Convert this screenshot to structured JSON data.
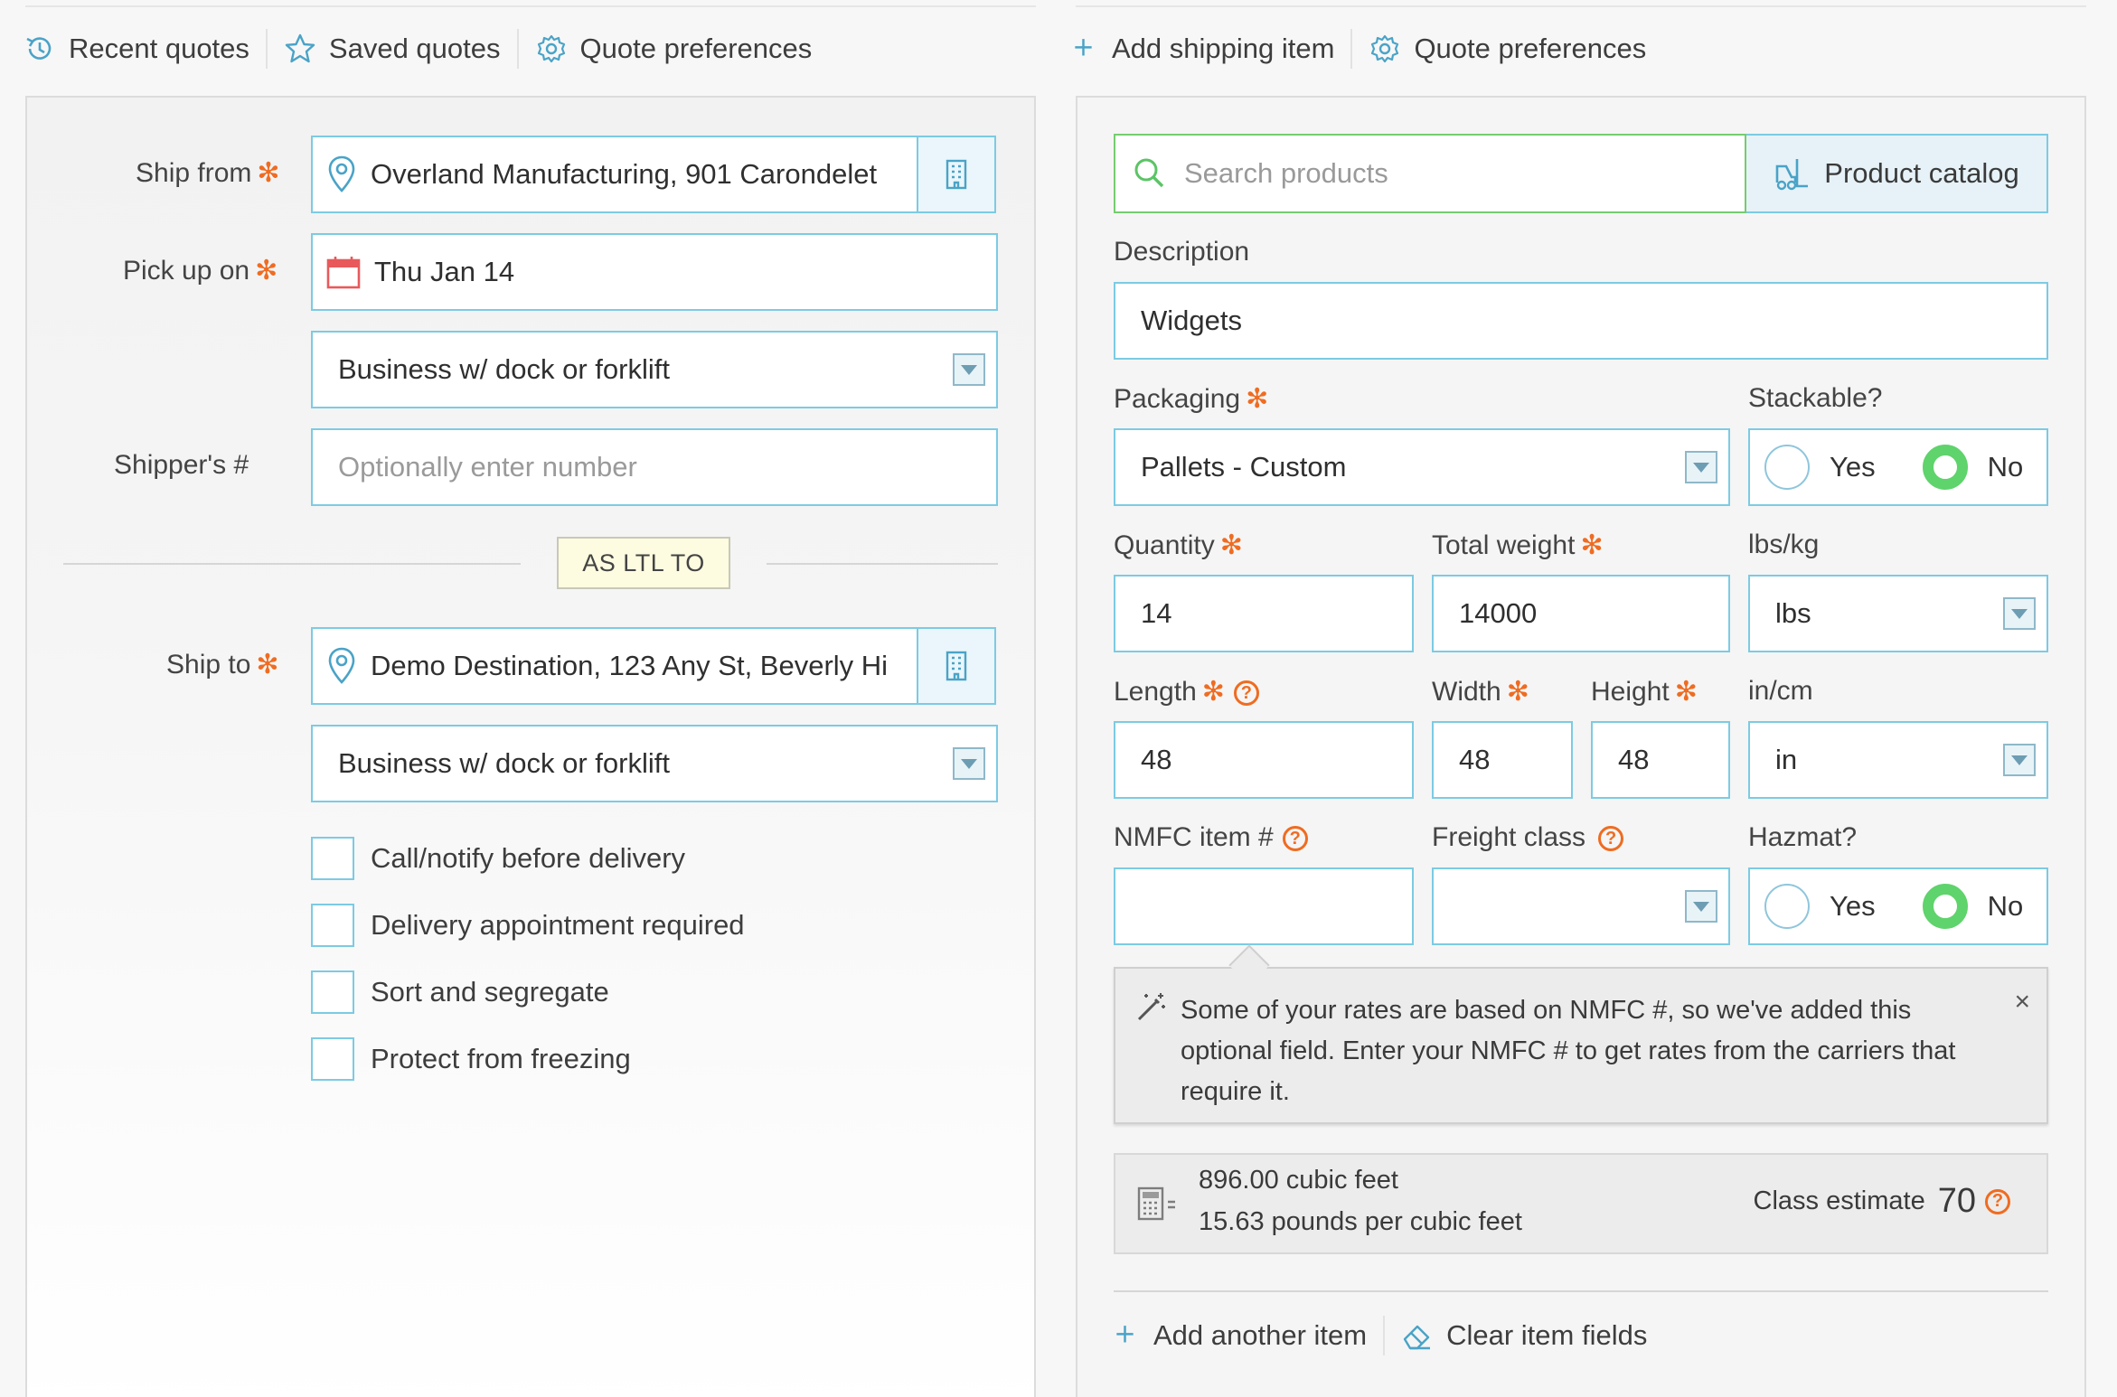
{
  "left_toolbar": {
    "recent_quotes": "Recent quotes",
    "saved_quotes": "Saved quotes",
    "quote_preferences": "Quote preferences"
  },
  "right_toolbar": {
    "add_shipping_item": "Add shipping item",
    "quote_preferences": "Quote preferences"
  },
  "origin": {
    "ship_from_label": "Ship from",
    "ship_from_value": "Overland Manufacturing, 901 Carondelet",
    "pickup_label": "Pick up on",
    "pickup_value": "Thu Jan 14",
    "origin_location_type": "Business w/ dock or forklift",
    "shippers_label": "Shipper's #",
    "shippers_placeholder": "Optionally enter number"
  },
  "mode_badge": "AS LTL TO",
  "destination": {
    "ship_to_label": "Ship to",
    "ship_to_value": "Demo Destination, 123 Any St, Beverly Hi",
    "dest_location_type": "Business w/ dock or forklift",
    "accessorials": [
      "Call/notify before delivery",
      "Delivery appointment required",
      "Sort and segregate",
      "Protect from freezing"
    ]
  },
  "item": {
    "search_placeholder": "Search products",
    "product_catalog": "Product catalog",
    "description_label": "Description",
    "description_value": "Widgets",
    "packaging_label": "Packaging",
    "packaging_value": "Pallets - Custom",
    "stackable_label": "Stackable?",
    "yes": "Yes",
    "no": "No",
    "quantity_label": "Quantity",
    "quantity_value": "14",
    "weight_label": "Total weight",
    "weight_value": "14000",
    "weight_unit_label": "lbs/kg",
    "weight_unit_value": "lbs",
    "length_label": "Length",
    "length_value": "48",
    "width_label": "Width",
    "width_value": "48",
    "height_label": "Height",
    "height_value": "48",
    "dim_unit_label": "in/cm",
    "dim_unit_value": "in",
    "nmfc_label": "NMFC item #",
    "freight_class_label": "Freight class",
    "hazmat_label": "Hazmat?",
    "stackable_selected": "No",
    "hazmat_selected": "No"
  },
  "tooltip": {
    "text": "Some of your rates are based on NMFC #, so we've added this optional field. Enter your NMFC # to get rates from the carriers that require it.",
    "close": "×"
  },
  "calc": {
    "cubic_feet": "896.00 cubic feet",
    "density": "15.63 pounds per cubic feet",
    "class_estimate_label": "Class estimate",
    "class_estimate_value": "70"
  },
  "bottom": {
    "add_another": "Add another item",
    "clear_fields": "Clear item fields"
  },
  "colors": {
    "accent_blue": "#4aa3c7",
    "required_orange": "#ef6c21",
    "selected_green": "#5fd36c"
  }
}
